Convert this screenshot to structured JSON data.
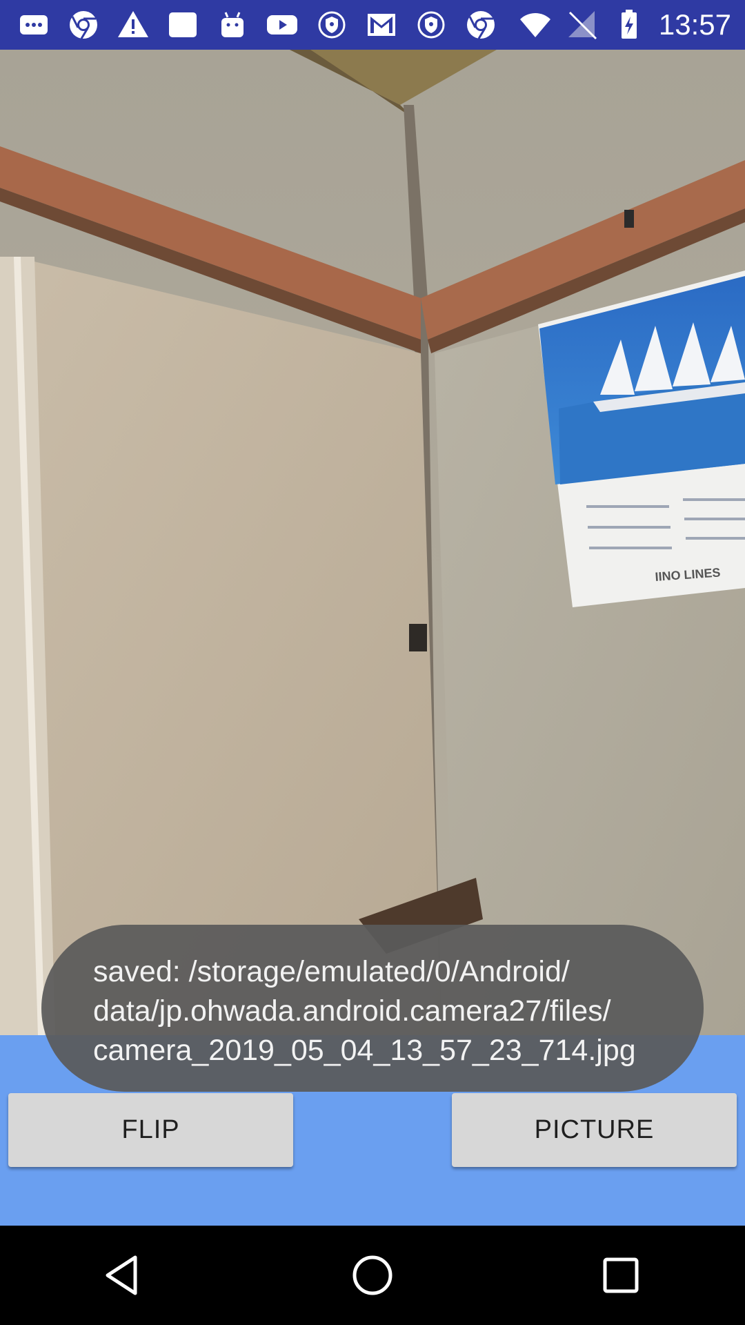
{
  "status_bar": {
    "time": "13:57",
    "notification_icons": [
      "messages-icon",
      "chrome-icon",
      "warning-icon",
      "photo-icon",
      "android-icon",
      "youtube-icon",
      "vpn-shield-icon",
      "gmail-icon",
      "vpn-shield-icon",
      "chrome-icon"
    ],
    "system_icons": [
      "wifi-icon",
      "no-signal-icon",
      "battery-charging-icon"
    ],
    "background_color": "#2f3aa3"
  },
  "preview": {
    "calendar_brand": "IINO LINES"
  },
  "toast": {
    "lines": [
      "saved: /storage/emulated/0/Android/",
      "data/jp.ohwada.android.camera27/files/",
      "camera_2019_05_04_13_57_23_714.jpg"
    ]
  },
  "controls": {
    "flip_label": "FLIP",
    "picture_label": "PICTURE",
    "background_color": "#6a9ff0"
  },
  "nav_bar": {
    "back": "back-icon",
    "home": "home-icon",
    "recents": "recents-icon"
  }
}
